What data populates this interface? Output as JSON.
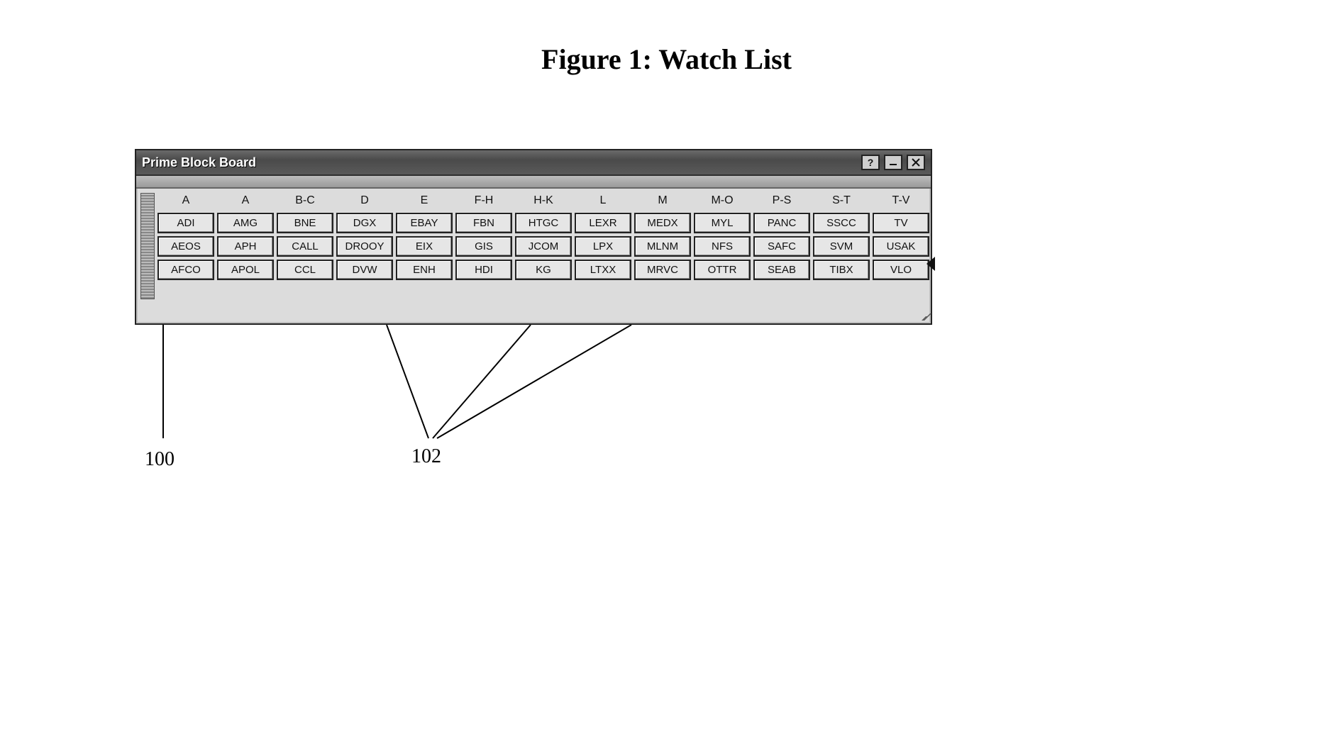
{
  "figure_caption": "Figure 1: Watch List",
  "window": {
    "title": "Prime Block Board",
    "help_tip": "Help",
    "minimize_tip": "Minimize",
    "close_tip": "Close"
  },
  "column_headers": [
    "A",
    "A",
    "B-C",
    "D",
    "E",
    "F-H",
    "H-K",
    "L",
    "M",
    "M-O",
    "P-S",
    "S-T",
    "T-V"
  ],
  "rows": [
    [
      "ADI",
      "AMG",
      "BNE",
      "DGX",
      "EBAY",
      "FBN",
      "HTGC",
      "LEXR",
      "MEDX",
      "MYL",
      "PANC",
      "SSCC",
      "TV"
    ],
    [
      "AEOS",
      "APH",
      "CALL",
      "DROOY",
      "EIX",
      "GIS",
      "JCOM",
      "LPX",
      "MLNM",
      "NFS",
      "SAFC",
      "SVM",
      "USAK"
    ],
    [
      "AFCO",
      "APOL",
      "CCL",
      "DVW",
      "ENH",
      "HDI",
      "KG",
      "LTXX",
      "MRVC",
      "OTTR",
      "SEAB",
      "TIBX",
      "VLO"
    ]
  ],
  "annotations": {
    "ref_100": "100",
    "ref_102": "102"
  }
}
